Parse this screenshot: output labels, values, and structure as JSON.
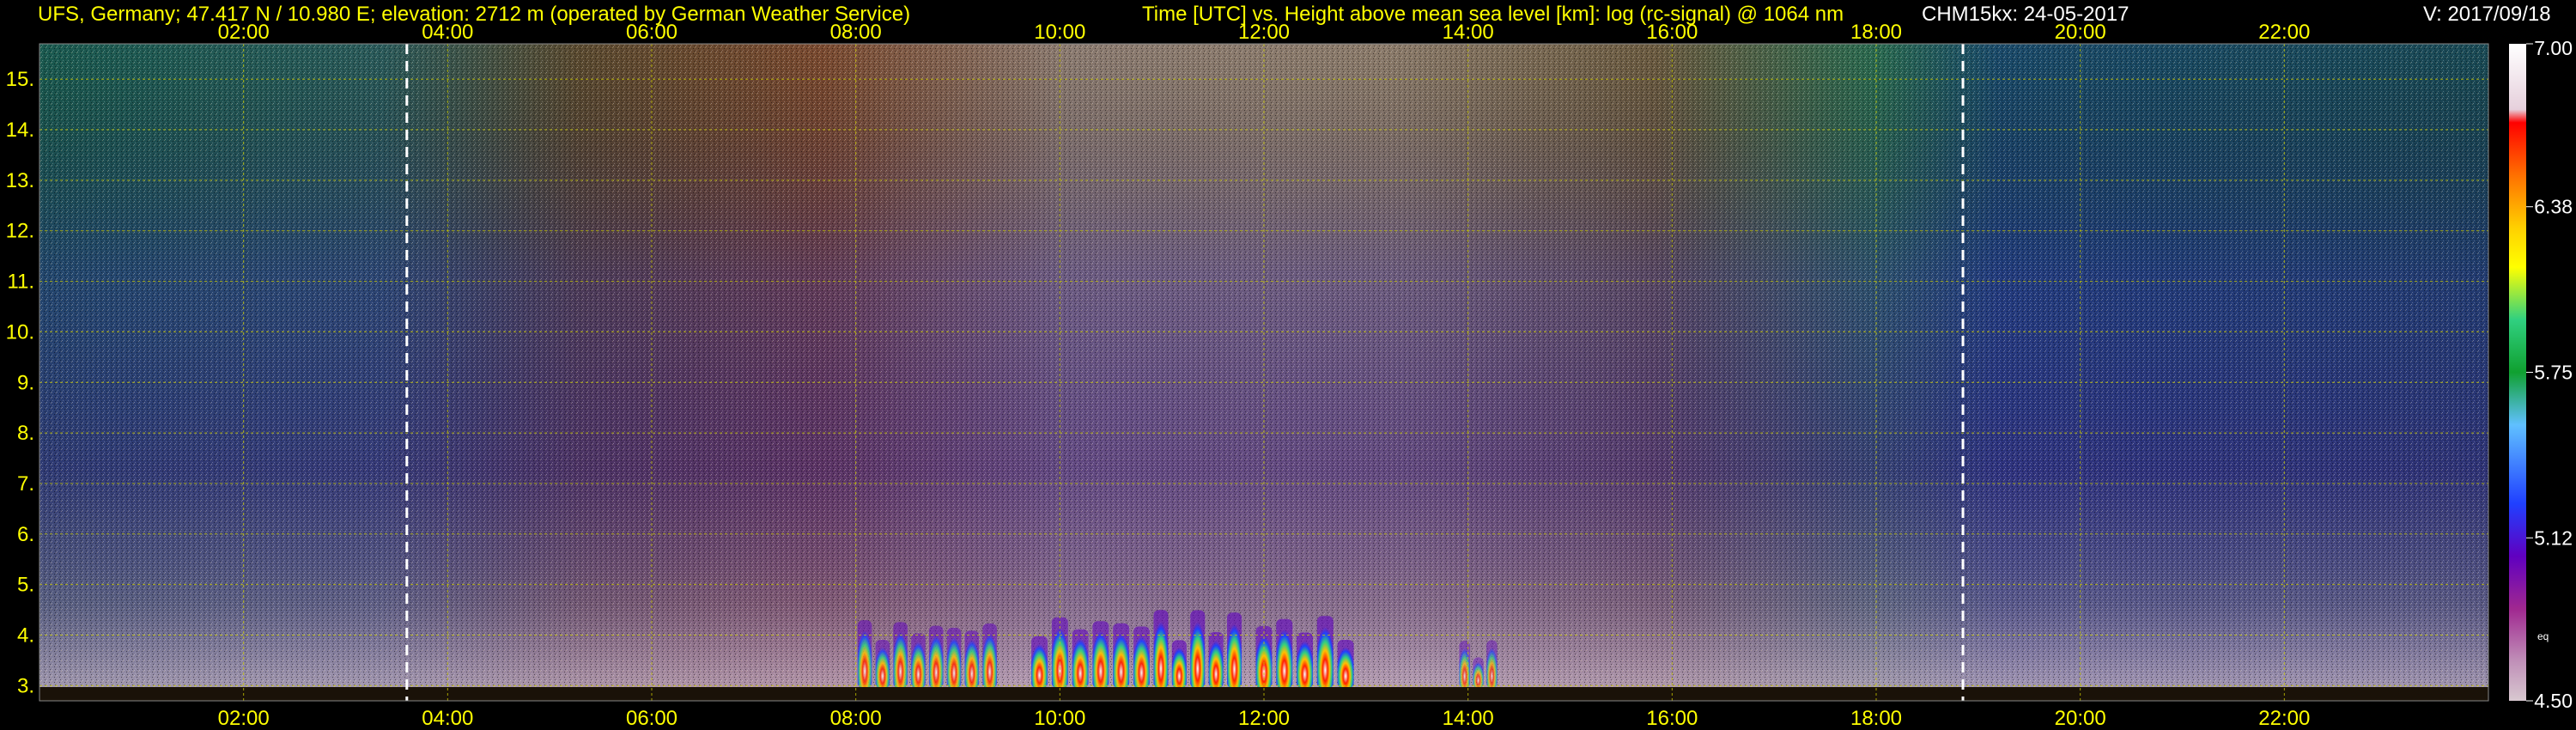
{
  "header": {
    "station": "UFS, Germany; 47.417 N / 10.980 E; elevation: 2712 m  (operated by German Weather Service)",
    "title": "Time [UTC] vs. Height above mean sea level [km]: log (rc-signal) @ 1064 nm",
    "instrument": "CHM15kx: 24-05-2017",
    "version": "V: 2017/09/18"
  },
  "colors": {
    "background": "#000000",
    "text": "#ffff00",
    "grid": "#c8c800",
    "marker_lines": "#ffffff"
  },
  "colorbar": {
    "ticks": [
      "7.00",
      "6.38",
      "5.75",
      "5.12",
      "4.50"
    ],
    "tick_values": [
      7.0,
      6.38,
      5.75,
      5.12,
      4.5
    ],
    "small_label": "eq",
    "colors": [
      "#ffffff",
      "#e6d0dc",
      "#ff0000",
      "#ff7000",
      "#ffd000",
      "#ffff00",
      "#30d080",
      "#10a030",
      "#60c0ff",
      "#2040ff",
      "#6000c0",
      "#a02890",
      "#c090b8",
      "#d8c8d0"
    ]
  },
  "chart_data": {
    "type": "heatmap",
    "title": "Time [UTC] vs. Height above mean sea level [km]: log (rc-signal) @ 1064 nm",
    "x_ticks": [
      "02:00",
      "04:00",
      "06:00",
      "08:00",
      "10:00",
      "12:00",
      "14:00",
      "16:00",
      "18:00",
      "20:00",
      "22:00"
    ],
    "x_tick_hours": [
      2,
      4,
      6,
      8,
      10,
      12,
      14,
      16,
      18,
      20,
      22
    ],
    "y_ticks": [
      "3.",
      "4.",
      "5.",
      "6.",
      "7.",
      "8.",
      "9.",
      "10.",
      "11.",
      "12.",
      "13.",
      "14.",
      "15."
    ],
    "y_tick_km": [
      3,
      4,
      5,
      6,
      7,
      8,
      9,
      10,
      11,
      12,
      13,
      14,
      15
    ],
    "xlim_hours": [
      0,
      24
    ],
    "ylim_km": [
      2.7,
      15.7
    ],
    "color_scale": [
      4.5,
      7.0
    ],
    "grid": true,
    "sunrise_sunset_hours": [
      3.6,
      18.85
    ],
    "clouds": [
      {
        "start_hour": 8.0,
        "end_hour": 9.4,
        "top_km": 4.3,
        "peak": 6.2
      },
      {
        "start_hour": 9.7,
        "end_hour": 10.9,
        "top_km": 4.4,
        "peak": 6.7
      },
      {
        "start_hour": 10.9,
        "end_hour": 11.8,
        "top_km": 4.5,
        "peak": 7.0
      },
      {
        "start_hour": 11.9,
        "end_hour": 12.9,
        "top_km": 4.4,
        "peak": 7.0
      },
      {
        "start_hour": 13.9,
        "end_hour": 14.3,
        "top_km": 3.9,
        "peak": 5.4
      }
    ]
  }
}
